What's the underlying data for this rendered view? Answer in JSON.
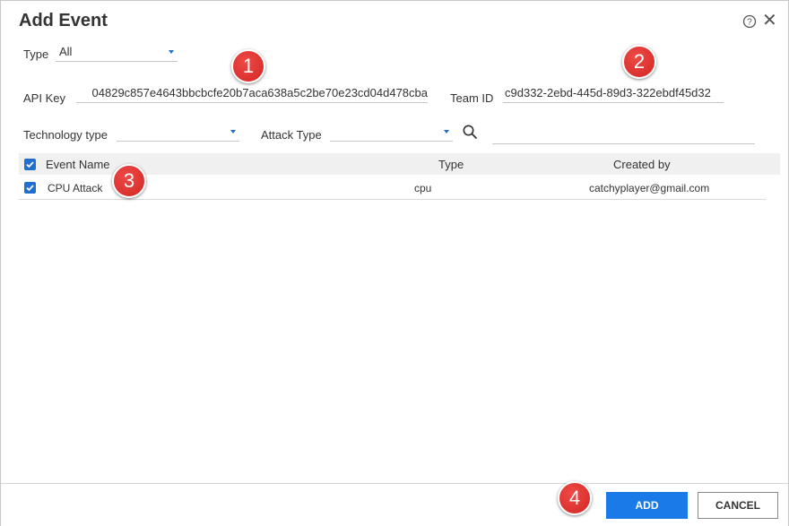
{
  "dialog": {
    "title": "Add Event",
    "help_icon": "question-circle-icon",
    "close_icon": "close-icon"
  },
  "form": {
    "type_label": "Type",
    "type_value": "All",
    "api_key_label": "API Key",
    "api_key_value": "04829c857e4643bbcbcfe20b7aca638a5c2be70e23cd04d478cba",
    "team_id_label": "Team ID",
    "team_id_value": "c9d332-2ebd-445d-89d3-322ebdf45d32",
    "technology_type_label": "Technology type",
    "technology_type_value": "",
    "attack_type_label": "Attack Type",
    "attack_type_value": "",
    "search_icon": "search-icon",
    "search_value": ""
  },
  "table": {
    "columns": [
      "Event Name",
      "Type",
      "Created by"
    ],
    "header_checked": true,
    "rows": [
      {
        "checked": true,
        "name": "CPU Attack",
        "type": "cpu",
        "created_by": "catchyplayer@gmail.com"
      }
    ]
  },
  "footer": {
    "add_label": "ADD",
    "cancel_label": "CANCEL"
  },
  "annotations": [
    "1",
    "2",
    "3",
    "4"
  ],
  "colors": {
    "accent": "#1a7ae8",
    "badge": "#d9302c"
  }
}
